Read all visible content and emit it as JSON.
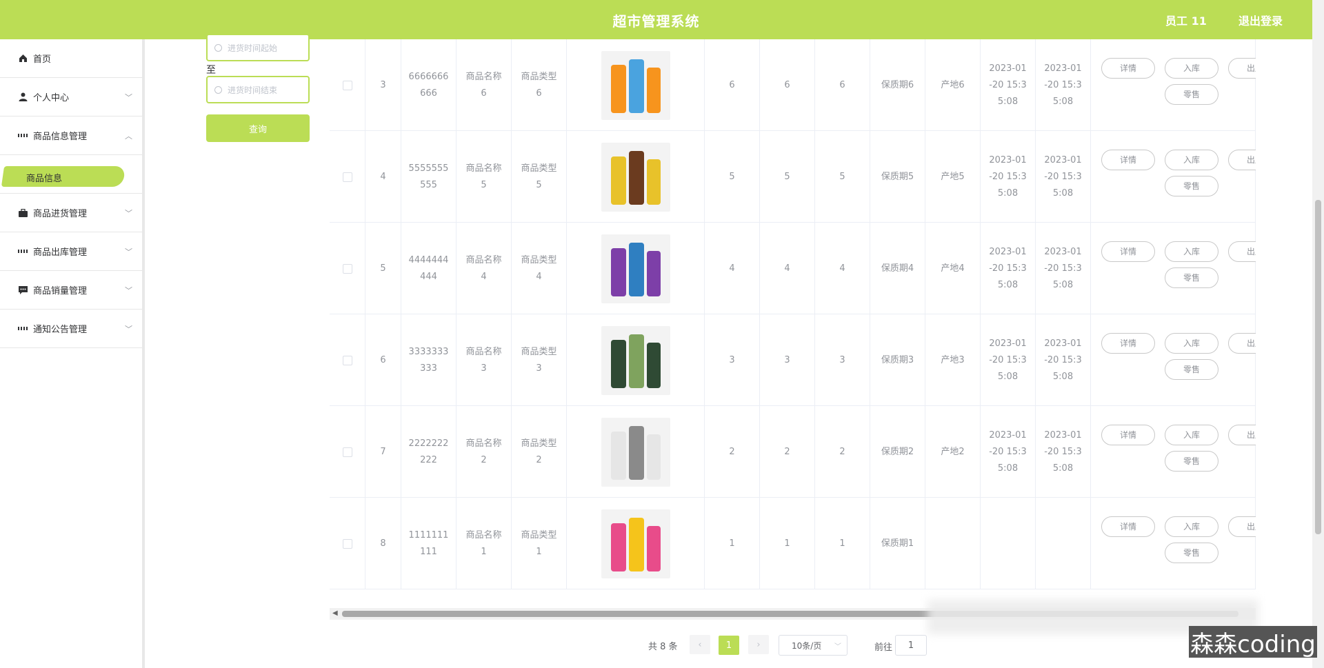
{
  "header": {
    "title": "超市管理系统",
    "user": "员工 11",
    "logout": "退出登录",
    "color": "#bbdd55"
  },
  "sidebar": {
    "items": [
      {
        "label": "首页",
        "icon": "home-icon"
      },
      {
        "label": "个人中心",
        "icon": "user-icon"
      },
      {
        "label": "商品信息管理",
        "icon": "grid-icon"
      },
      {
        "label": "商品进货管理",
        "icon": "briefcase-icon"
      },
      {
        "label": "商品出库管理",
        "icon": "grid-icon"
      },
      {
        "label": "商品销量管理",
        "icon": "chat-icon"
      },
      {
        "label": "通知公告管理",
        "icon": "grid-icon"
      }
    ],
    "active_sub": "商品信息"
  },
  "filter": {
    "start_placeholder": "进货时间起始",
    "to_label": "至",
    "end_placeholder": "进货时间结束",
    "query_label": "查询"
  },
  "table": {
    "rows": [
      {
        "id": "3",
        "code_a": "6666666",
        "code_b": "666",
        "name_a": "商品名称",
        "name_b": "6",
        "type_a": "商品类型",
        "type_b": "6",
        "image": "orange-drink-bottles",
        "n1": "6",
        "n2": "6",
        "n3": "6",
        "shelf": "保质期6",
        "origin": "产地6",
        "t1_a": "2023-01",
        "t1_b": "-20 15:3",
        "t1_c": "5:08",
        "t2_a": "2023-01",
        "t2_b": "-20 15:3",
        "t2_c": "5:08"
      },
      {
        "id": "4",
        "code_a": "5555555",
        "code_b": "555",
        "name_a": "商品名称",
        "name_b": "5",
        "type_a": "商品类型",
        "type_b": "5",
        "image": "chocolate-packs",
        "n1": "5",
        "n2": "5",
        "n3": "5",
        "shelf": "保质期5",
        "origin": "产地5",
        "t1_a": "2023-01",
        "t1_b": "-20 15:3",
        "t1_c": "5:08",
        "t2_a": "2023-01",
        "t2_b": "-20 15:3",
        "t2_c": "5:08"
      },
      {
        "id": "5",
        "code_a": "4444444",
        "code_b": "444",
        "name_a": "商品名称",
        "name_b": "4",
        "type_a": "商品类型",
        "type_b": "4",
        "image": "purple-book-set",
        "n1": "4",
        "n2": "4",
        "n3": "4",
        "shelf": "保质期4",
        "origin": "产地4",
        "t1_a": "2023-01",
        "t1_b": "-20 15:3",
        "t1_c": "5:08",
        "t2_a": "2023-01",
        "t2_b": "-20 15:3",
        "t2_c": "5:08"
      },
      {
        "id": "6",
        "code_a": "3333333",
        "code_b": "333",
        "name_a": "商品名称",
        "name_b": "3",
        "type_a": "商品类型",
        "type_b": "3",
        "image": "cosmetic-bottles-green",
        "n1": "3",
        "n2": "3",
        "n3": "3",
        "shelf": "保质期3",
        "origin": "产地3",
        "t1_a": "2023-01",
        "t1_b": "-20 15:3",
        "t1_c": "5:08",
        "t2_a": "2023-01",
        "t2_b": "-20 15:3",
        "t2_c": "5:08"
      },
      {
        "id": "7",
        "code_a": "2222222",
        "code_b": "222",
        "name_a": "商品名称",
        "name_b": "2",
        "type_a": "商品类型",
        "type_b": "2",
        "image": "skincare-bottles-white",
        "n1": "2",
        "n2": "2",
        "n3": "2",
        "shelf": "保质期2",
        "origin": "产地2",
        "t1_a": "2023-01",
        "t1_b": "-20 15:3",
        "t1_c": "5:08",
        "t2_a": "2023-01",
        "t2_b": "-20 15:3",
        "t2_c": "5:08"
      },
      {
        "id": "8",
        "code_a": "1111111",
        "code_b": "111",
        "name_a": "商品名称",
        "name_b": "1",
        "type_a": "商品类型",
        "type_b": "1",
        "image": "children-book-set",
        "n1": "1",
        "n2": "1",
        "n3": "1",
        "shelf": "保质期1",
        "origin": "",
        "t1_a": "",
        "t1_b": "",
        "t1_c": "",
        "t2_a": "",
        "t2_b": "",
        "t2_c": ""
      }
    ],
    "actions": {
      "detail": "详情",
      "stock_in": "入库",
      "stock_out": "出库",
      "retail": "零售"
    }
  },
  "pagination": {
    "total": "共 8 条",
    "current": "1",
    "page_size": "10条/页",
    "goto_label": "前往",
    "goto_value": "1"
  },
  "watermark": "森森coding"
}
